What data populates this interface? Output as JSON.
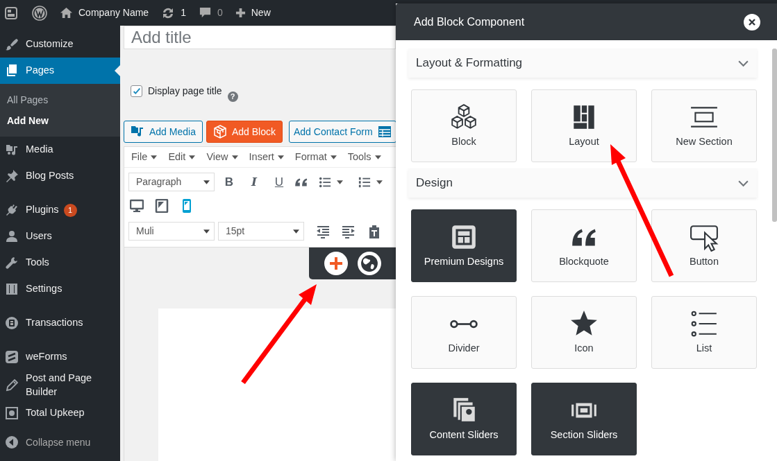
{
  "admin_bar": {
    "site_name": "Company Name",
    "updates_count": "1",
    "comments_count": "0",
    "new_label": "New"
  },
  "sidebar": {
    "groups": [
      {
        "items": [
          {
            "label": "Customize",
            "selected": false
          },
          {
            "label": "Pages",
            "selected": true,
            "children": [
              {
                "label": "All Pages",
                "selected": false
              },
              {
                "label": "Add New",
                "selected": true
              }
            ]
          },
          {
            "label": "Media",
            "selected": false
          },
          {
            "label": "Blog Posts",
            "selected": false
          }
        ]
      },
      {
        "items": [
          {
            "label": "Plugins",
            "selected": false,
            "badge": "1"
          },
          {
            "label": "Users",
            "selected": false
          },
          {
            "label": "Tools",
            "selected": false
          },
          {
            "label": "Settings",
            "selected": false
          }
        ]
      },
      {
        "items": [
          {
            "label": "Transactions",
            "selected": false
          }
        ]
      },
      {
        "items": [
          {
            "label": "weForms",
            "selected": false
          },
          {
            "label": "Post and Page Builder",
            "selected": false
          },
          {
            "label": "Total Upkeep",
            "selected": false
          }
        ]
      }
    ],
    "collapse_label": "Collapse menu"
  },
  "editor": {
    "title_placeholder": "Add title",
    "display_title": {
      "label": "Display page title",
      "checked": true
    },
    "help_glyph": "?",
    "buttons": [
      {
        "label": "Add Media",
        "kind": "media"
      },
      {
        "label": "Add Block",
        "kind": "primary"
      },
      {
        "label": "Add Contact Form",
        "kind": "form"
      }
    ],
    "menus": [
      "File",
      "Edit",
      "View",
      "Insert",
      "Format",
      "Tools"
    ],
    "block_format": "Paragraph",
    "format_buttons": [
      "B",
      "I",
      "U"
    ],
    "devices": [
      {
        "selected": false
      },
      {
        "selected": false
      },
      {
        "selected": true
      }
    ],
    "font_family": "Muli",
    "font_size": "15pt"
  },
  "panel": {
    "title": "Add Block Component",
    "sections": [
      {
        "title": "Layout & Formatting",
        "expanded": true,
        "items": [
          {
            "label": "Block",
            "kind": "standard"
          },
          {
            "label": "Layout",
            "kind": "standard"
          },
          {
            "label": "New Section",
            "kind": "standard"
          }
        ]
      },
      {
        "title": "Design",
        "expanded": true,
        "items": [
          {
            "label": "Premium Designs",
            "kind": "premium"
          },
          {
            "label": "Blockquote",
            "kind": "standard"
          },
          {
            "label": "Button",
            "kind": "standard"
          },
          {
            "label": "Divider",
            "kind": "standard"
          },
          {
            "label": "Icon",
            "kind": "standard"
          },
          {
            "label": "List",
            "kind": "standard"
          },
          {
            "label": "Content Sliders",
            "kind": "premium"
          },
          {
            "label": "Section Sliders",
            "kind": "premium"
          }
        ]
      }
    ]
  }
}
